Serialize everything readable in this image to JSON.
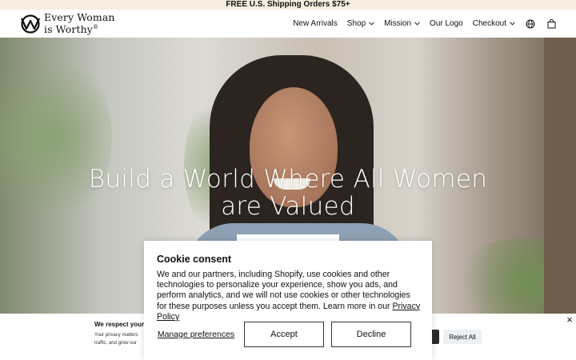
{
  "announcement": {
    "text": "FREE U.S. Shipping Orders $75+"
  },
  "header": {
    "logo_line1": "Every Woman",
    "logo_line2": "is Worthy",
    "logo_mark": "®",
    "nav": [
      {
        "label": "New Arrivals",
        "has_dropdown": false
      },
      {
        "label": "Shop",
        "has_dropdown": true
      },
      {
        "label": "Mission",
        "has_dropdown": true
      },
      {
        "label": "Our Logo",
        "has_dropdown": false
      },
      {
        "label": "Checkout",
        "has_dropdown": true
      }
    ],
    "icons": [
      "globe-icon",
      "shopping-bag-icon"
    ]
  },
  "hero": {
    "title_line1": "Build a World Where All Women",
    "title_line2": "are Valued"
  },
  "privacy_bar": {
    "title": "We respect your p",
    "text_line1": "Your privacy matters",
    "text_line2": "traffic, and grow our",
    "reject_label": "Reject All",
    "close_glyph": "×"
  },
  "cookie_modal": {
    "title": "Cookie consent",
    "body": "We and our partners, including Shopify, use cookies and other technologies to personalize your experience, show you ads, and perform analytics, and we will not use cookies or other technologies for these purposes unless you accept them. Learn more in our ",
    "link": "Privacy Policy",
    "manage_label": "Manage preferences",
    "accept_label": "Accept",
    "decline_label": "Decline"
  },
  "colors": {
    "announcement_bg": "#f6ece0",
    "text": "#111111",
    "hero_title": "#ffffff"
  }
}
